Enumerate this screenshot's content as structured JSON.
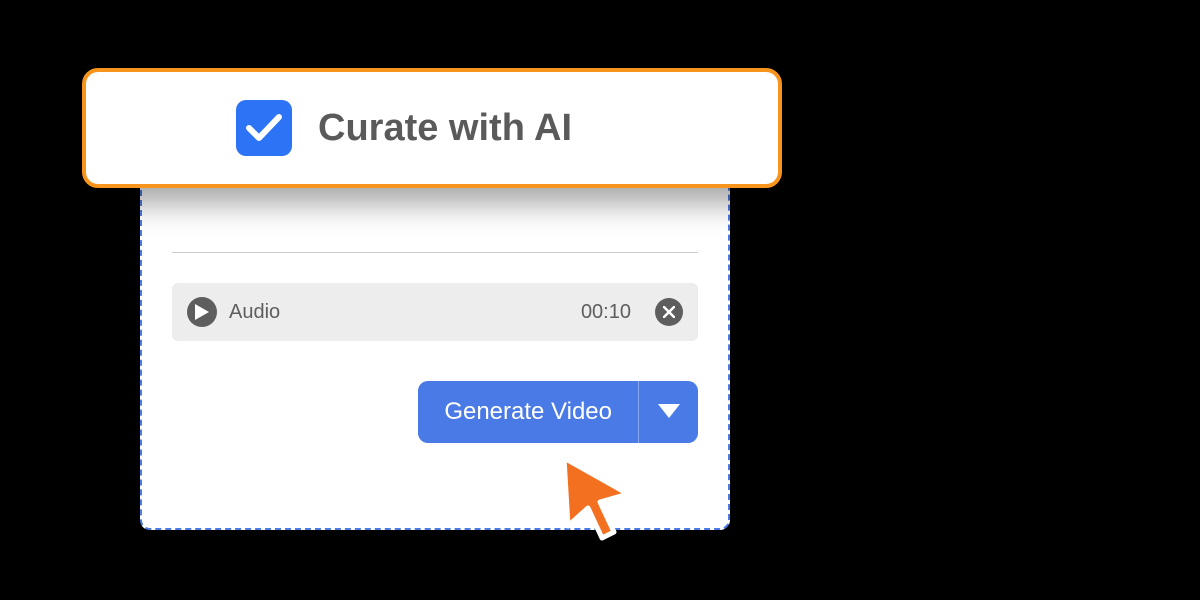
{
  "curate": {
    "checked": true,
    "label": "Curate with AI"
  },
  "audio": {
    "label": "Audio",
    "time": "00:10"
  },
  "generate": {
    "label": "Generate Video"
  }
}
